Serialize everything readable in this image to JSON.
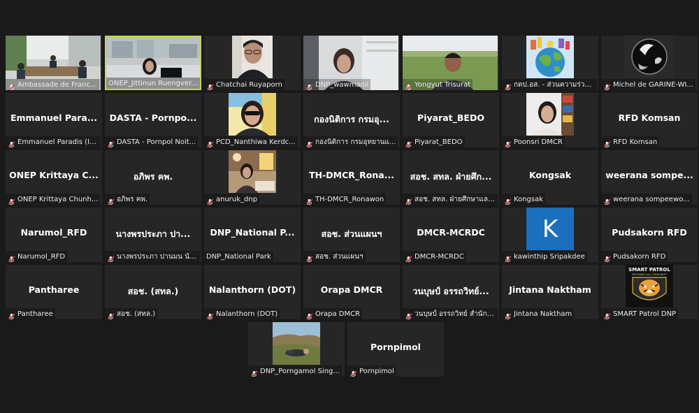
{
  "participants": [
    {
      "label": "Ambassade de Franc...",
      "muted": true,
      "video": "office-meeting"
    },
    {
      "label": "ONEP_Jittinun Ruengver...",
      "muted": false,
      "video": "woman-window",
      "active": true
    },
    {
      "label": "Chatchai Ruyaporn",
      "muted": true,
      "video": "man-glasses"
    },
    {
      "label": "DNP_wawmanii",
      "muted": true,
      "video": "woman-office"
    },
    {
      "label": "Yongyut Trisurat",
      "muted": true,
      "video": "man-field"
    },
    {
      "label": "กตป.อส. - ส่วนความร่วม...",
      "muted": true,
      "video": "globe-world"
    },
    {
      "label": "Michel de GARINE-WI...",
      "muted": true,
      "video": "crystal-ball"
    },
    {
      "label": "Emmanuel Paradis (IR...",
      "big": "Emmanuel  Para...",
      "muted": true
    },
    {
      "label": "DASTA - Pornpol Noit...",
      "big": "DASTA - Pornpo...",
      "muted": true
    },
    {
      "label": "PCD_Nanthiwa Kerdc...",
      "muted": true,
      "video": "woman-sunglasses"
    },
    {
      "label": "กองนิติการ กรมอุทยานแ...",
      "big": "กองนิติการ กรมอุ...",
      "muted": true
    },
    {
      "label": "Piyarat_BEDO",
      "big": "Piyarat_BEDO",
      "muted": true
    },
    {
      "label": "Poonsri DMCR",
      "muted": true,
      "video": "woman-bookshelf"
    },
    {
      "label": "RFD Komsan",
      "big": "RFD Komsan",
      "muted": true
    },
    {
      "label": "ONEP Krittaya Chunh...",
      "big": "ONEP  Krittaya C...",
      "muted": true
    },
    {
      "label": "อภิพร คพ.",
      "big": "อภิพร คพ.",
      "muted": true
    },
    {
      "label": "anuruk_dnp",
      "muted": true,
      "video": "woman-desk"
    },
    {
      "label": "TH-DMCR_Ronawon",
      "big": "TH-DMCR_Rona...",
      "muted": true
    },
    {
      "label": "สอช. สทล. ฝ่ายศึกษาและ...",
      "big": "สอช. สทล. ฝ่ายศึก...",
      "muted": true
    },
    {
      "label": "Kongsak",
      "big": "Kongsak",
      "muted": true
    },
    {
      "label": "weerana sompeewo...",
      "big": "weerana  sompe...",
      "muted": true
    },
    {
      "label": "Narumol_RFD",
      "big": "Narumol_RFD",
      "muted": true
    },
    {
      "label": "นางพรประภา ปานมน นัก...",
      "big": "นางพรประภา ปา...",
      "muted": true
    },
    {
      "label": "DNP_National Park",
      "big": "DNP_National  P...",
      "muted": false
    },
    {
      "label": "สอช. ส่วนแผนฯ",
      "big": "สอช. ส่วนแผนฯ",
      "muted": true
    },
    {
      "label": "DMCR-MCRDC",
      "big": "DMCR-MCRDC",
      "muted": true
    },
    {
      "label": "kawinthip Sripakdee",
      "muted": true,
      "avatar": "K"
    },
    {
      "label": "Pudsakorn RFD",
      "big": "Pudsakorn RFD",
      "muted": true
    },
    {
      "label": "Pantharee",
      "big": "Pantharee",
      "muted": true
    },
    {
      "label": "สอช. (สทล.)",
      "big": "สอช. (สทล.)",
      "muted": true
    },
    {
      "label": "Nalanthorn (DOT)",
      "big": "Nalanthorn (DOT)",
      "muted": true
    },
    {
      "label": "Orapa DMCR",
      "big": "Orapa DMCR",
      "muted": true
    },
    {
      "label": "วนบุษป์ อรรถวิทย์ สำนักอุ...",
      "big": "วนบุษป์ อรรถวิทย์...",
      "muted": true
    },
    {
      "label": "Jintana Naktham",
      "big": "Jintana Naktham",
      "muted": true
    },
    {
      "label": "SMART Patrol DNP",
      "muted": true,
      "video": "smart-patrol-logo"
    },
    {
      "label": "DNP_Porngamol Sing...",
      "muted": true,
      "video": "person-lying-field"
    },
    {
      "label": "Pornpimol",
      "big": "Pornpimol",
      "muted": true
    }
  ],
  "logo": {
    "line1": "SMART PATROL",
    "line2": "PROGRAM and COMMUNITY"
  }
}
